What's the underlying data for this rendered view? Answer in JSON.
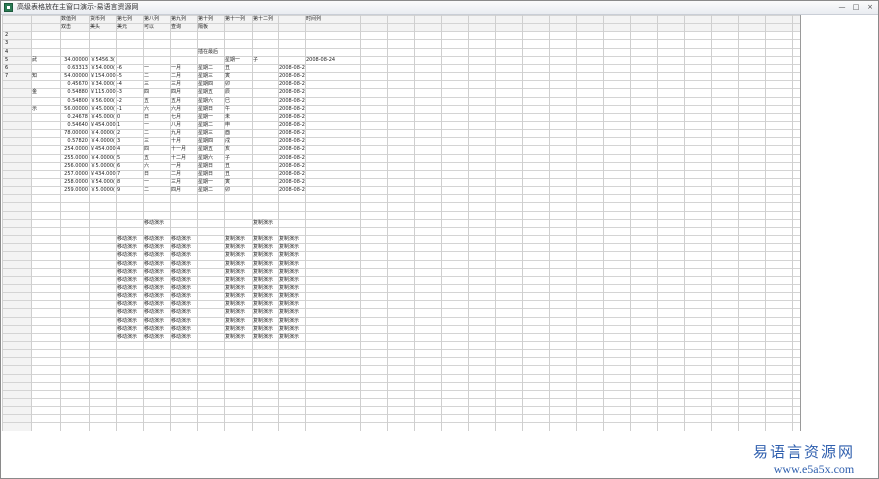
{
  "window": {
    "title": "高级表格放在主窗口演示-易语言资源网"
  },
  "controls": {
    "minimize": "—",
    "maximize": "□",
    "close": "×"
  },
  "header_row1": [
    "数值列",
    "货币列",
    "第七列",
    "第八列",
    "第九列",
    "第十列",
    "第十一列",
    "第十二列",
    "",
    "时间列"
  ],
  "header_row2": [
    "双击",
    "美头",
    "美元",
    "可以",
    "查询",
    "隔板",
    "",
    "",
    "",
    ""
  ],
  "row_numbers": [
    "2",
    "3",
    "4",
    "5",
    "6",
    "7"
  ],
  "side_labels": [
    "武",
    "知",
    "金",
    "示"
  ],
  "special_label": "插在最后",
  "rows": [
    [
      "34.00000",
      "￥5456.3(",
      "",
      "",
      "",
      "",
      "星期一",
      "子",
      "",
      "2008-08-24"
    ],
    [
      "0.63313",
      "￥54.000(",
      "-6",
      "一",
      "一月",
      "星期二",
      "丑",
      "",
      "2008-08-24"
    ],
    [
      "54.00000",
      "￥154.000",
      "-5",
      "二",
      "二月",
      "星期三",
      "寅",
      "",
      "2008-08-24"
    ],
    [
      "0.45670",
      "￥34.000(",
      "-4",
      "三",
      "三月",
      "星期四",
      "卯",
      "",
      "2008-08-24"
    ],
    [
      "0.54880",
      "￥115.000",
      "-3",
      "四",
      "四月",
      "星期五",
      "辰",
      "",
      "2008-08-24"
    ],
    [
      "0.54800",
      "￥56.000(",
      "-2",
      "五",
      "五月",
      "星期六",
      "巳",
      "",
      "2008-08-24"
    ],
    [
      "56.00000",
      "￥45.000(",
      "-1",
      "六",
      "六月",
      "星期日",
      "午",
      "",
      "2008-08-24"
    ],
    [
      "0.24678",
      "￥45.000(",
      "0",
      "日",
      "七月",
      "星期一",
      "未",
      "",
      "2008-08-24"
    ],
    [
      "0.54640",
      "￥454.000",
      "1",
      "一",
      "八月",
      "星期二",
      "申",
      "",
      "2008-08-24"
    ],
    [
      "78.00000",
      "￥4.0000(",
      "2",
      "二",
      "九月",
      "星期三",
      "酉",
      "",
      "2008-08-24"
    ],
    [
      "0.57820",
      "￥4.0000(",
      "3",
      "三",
      "十月",
      "星期四",
      "戌",
      "",
      "2008-08-24"
    ],
    [
      "254.0000",
      "￥454.000",
      "4",
      "四",
      "十一月",
      "星期五",
      "亥",
      "",
      "2008-08-24"
    ],
    [
      "255.0000",
      "￥4.0000(",
      "5",
      "五",
      "十二月",
      "星期六",
      "子",
      "",
      "2008-08-24"
    ],
    [
      "256.0000",
      "￥5.0000(",
      "6",
      "六",
      "一月",
      "星期日",
      "丑",
      "",
      "2008-08-24"
    ],
    [
      "257.0000",
      "￥434.000",
      "7",
      "日",
      "二月",
      "星期日",
      "丑",
      "",
      "2008-08-24"
    ],
    [
      "258.0000",
      "￥54.000(",
      "8",
      "一",
      "三月",
      "星期一",
      "寅",
      "",
      "2008-08-24"
    ],
    [
      "259.0000",
      "￥5.0000(",
      "9",
      "二",
      "四月",
      "星期二",
      "卯",
      "",
      "2008-08-24"
    ]
  ],
  "move_title": "移动演示",
  "copy_title": "复制演示",
  "move_cell": "移动演示",
  "copy_cell": "复制演示",
  "block_rows": 13,
  "watermark": {
    "zh": "易语言资源网",
    "url": "www.e5a5x.com"
  }
}
